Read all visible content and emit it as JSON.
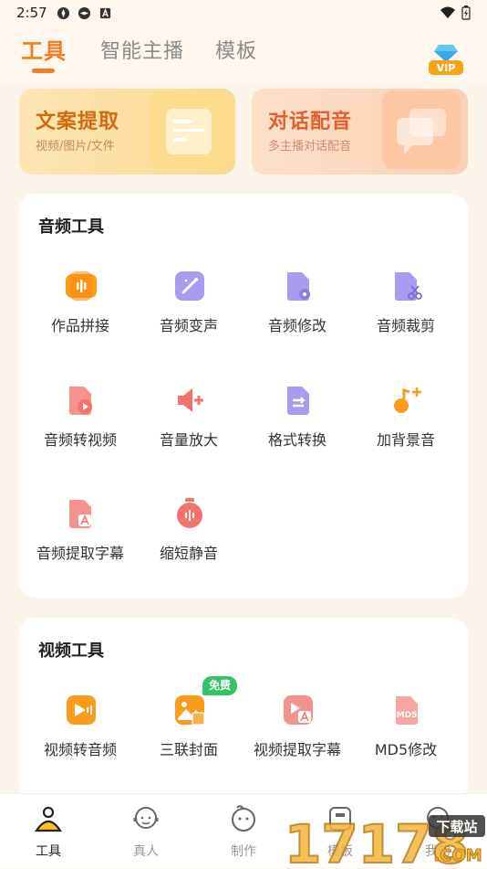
{
  "status_bar": {
    "time": "2:57"
  },
  "tabs": [
    {
      "label": "工具",
      "active": true
    },
    {
      "label": "智能主播",
      "active": false
    },
    {
      "label": "模板",
      "active": false
    }
  ],
  "vip": {
    "label": "VIP"
  },
  "top_cards": [
    {
      "title": "文案提取",
      "subtitle": "视频/图片/文件"
    },
    {
      "title": "对话配音",
      "subtitle": "多主播对话配音"
    }
  ],
  "audio_tools": {
    "title": "音频工具",
    "items": [
      {
        "label": "作品拼接",
        "icon": "waveform-icon"
      },
      {
        "label": "音频变声",
        "icon": "magic-wand-icon"
      },
      {
        "label": "音频修改",
        "icon": "audio-file-gear-icon"
      },
      {
        "label": "音频裁剪",
        "icon": "audio-file-scissors-icon"
      },
      {
        "label": "音频转视频",
        "icon": "audio-to-video-icon"
      },
      {
        "label": "音量放大",
        "icon": "speaker-plus-icon"
      },
      {
        "label": "格式转换",
        "icon": "file-convert-icon"
      },
      {
        "label": "加背景音",
        "icon": "music-note-plus-icon"
      },
      {
        "label": "音频提取字幕",
        "icon": "subtitle-file-icon"
      },
      {
        "label": "缩短静音",
        "icon": "timer-icon"
      }
    ]
  },
  "video_tools": {
    "title": "视频工具",
    "badge": "免费",
    "items": [
      {
        "label": "视频转音频",
        "icon": "video-to-audio-icon"
      },
      {
        "label": "三联封面",
        "icon": "cover-image-icon"
      },
      {
        "label": "视频提取字幕",
        "icon": "video-subtitle-icon"
      },
      {
        "label": "MD5修改",
        "icon": "md5-file-icon"
      }
    ]
  },
  "bottom_nav": [
    {
      "label": "工具",
      "active": true,
      "icon": "tool-person-icon"
    },
    {
      "label": "真人",
      "active": false,
      "icon": "headset-person-icon"
    },
    {
      "label": "制作",
      "active": false,
      "icon": "face-icon"
    },
    {
      "label": "模板",
      "active": false,
      "icon": "template-icon"
    },
    {
      "label": "我的",
      "active": false,
      "icon": "profile-icon"
    }
  ],
  "watermark": {
    "text": "17178",
    "sub": "下载站",
    "domain": ".COM"
  },
  "colors": {
    "accent": "#f57c1f",
    "page_bg": "#fbf4ea",
    "badge": "#34c265",
    "audio_icon_purple": "#a99cf0",
    "icon_red": "#f4726a",
    "icon_orange": "#fb9b1c"
  }
}
